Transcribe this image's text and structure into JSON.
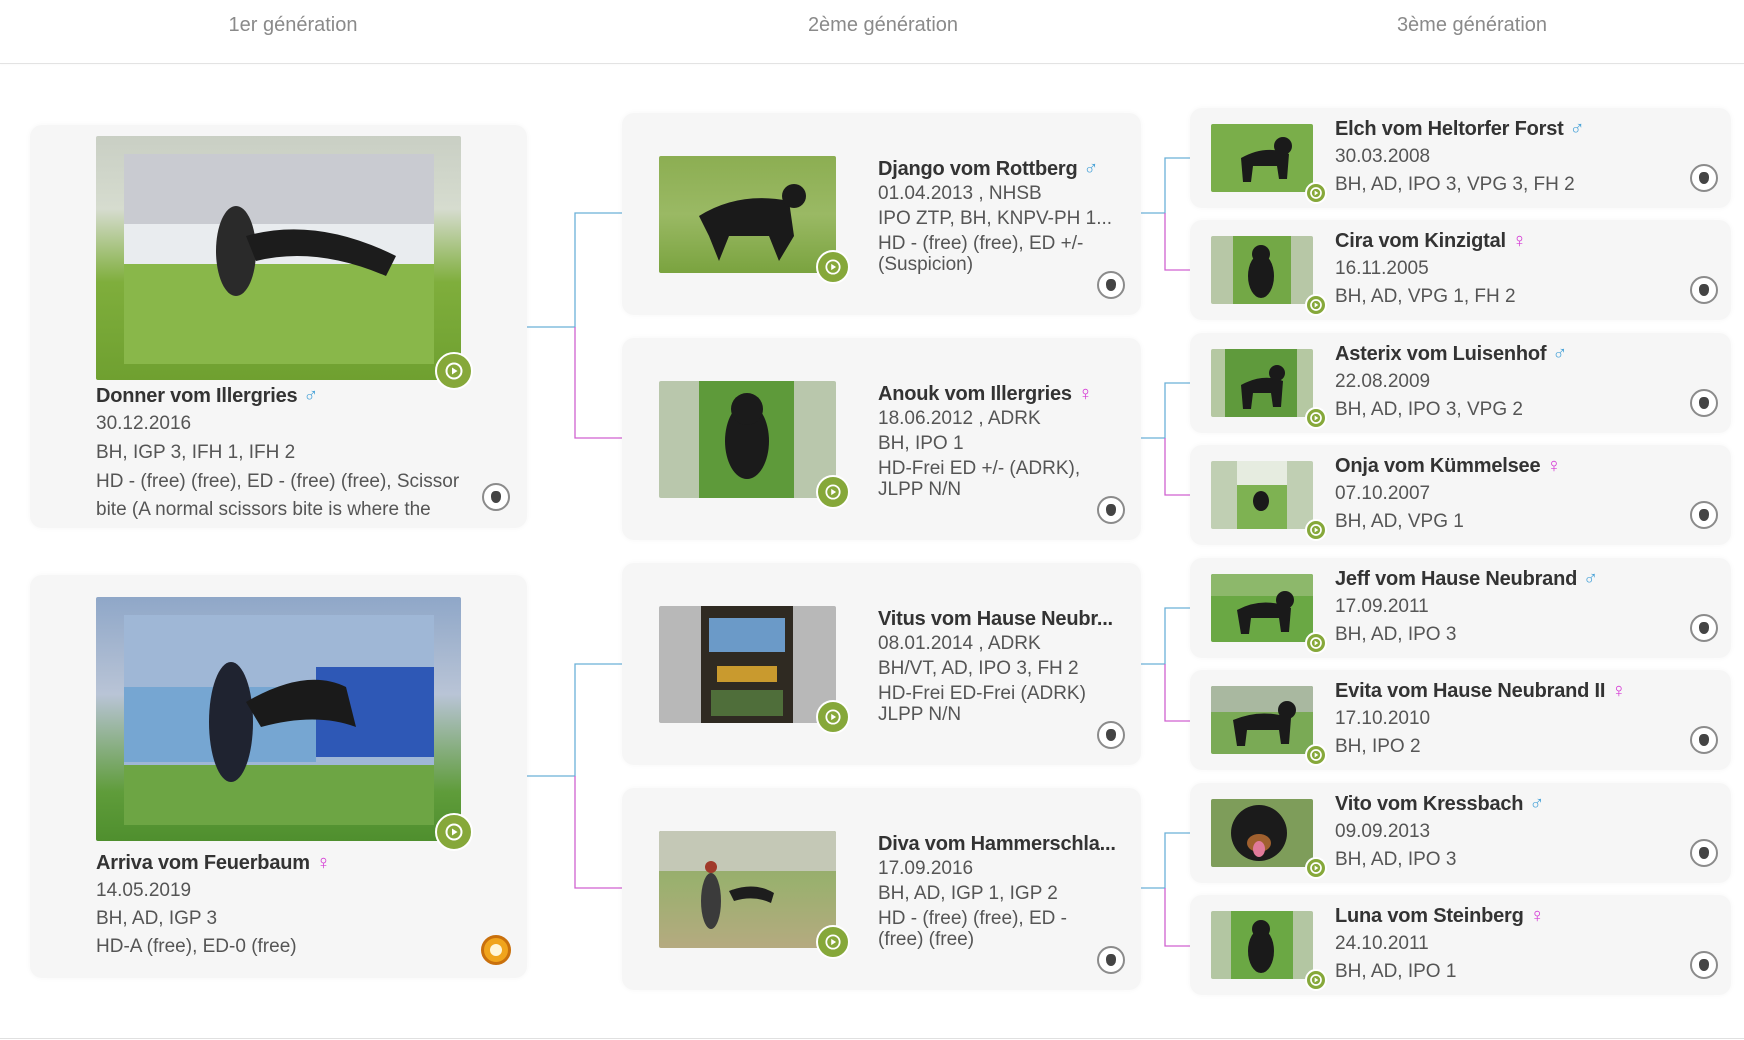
{
  "headers": [
    "1er génération",
    "2ème génération",
    "3ème génération"
  ],
  "gen1": [
    {
      "name": "Donner vom Illergries",
      "sex": "♂",
      "date": "30.12.2016",
      "titles": "BH, IGP 3, IFH 1, IFH 2",
      "health": "HD - (free) (free), ED - (free) (free), Scissor bite (A normal scissors bite is where the"
    },
    {
      "name": "Arriva vom Feuerbaum",
      "sex": "♀",
      "date": "14.05.2019",
      "titles": "BH, AD, IGP 3",
      "health": "HD-A (free), ED-0 (free)"
    }
  ],
  "gen2": [
    {
      "name": "Django vom Rottberg",
      "sex": "♂",
      "date": "01.04.2013 , NHSB",
      "titles": "IPO ZTP, BH, KNPV-PH 1...",
      "health": "HD - (free) (free), ED +/- (Suspicion)"
    },
    {
      "name": "Anouk vom Illergries",
      "sex": "♀",
      "date": "18.06.2012 , ADRK",
      "titles": "BH, IPO 1",
      "health": "HD-Frei ED +/- (ADRK), JLPP N/N"
    },
    {
      "name": "Vitus vom Hause Neubr...",
      "sex": "",
      "date": "08.01.2014 , ADRK",
      "titles": "BH/VT, AD, IPO 3, FH 2",
      "health": "HD-Frei ED-Frei (ADRK) JLPP N/N"
    },
    {
      "name": "Diva vom Hammerschla...",
      "sex": "",
      "date": "17.09.2016",
      "titles": "BH, AD, IGP 1, IGP 2",
      "health": "HD - (free) (free), ED - (free) (free)"
    }
  ],
  "gen3": [
    {
      "name": "Elch vom Heltorfer Forst",
      "sex": "♂",
      "date": "30.03.2008",
      "titles": "BH, AD, IPO 3, VPG 3, FH 2"
    },
    {
      "name": "Cira vom Kinzigtal",
      "sex": "♀",
      "date": "16.11.2005",
      "titles": "BH, AD, VPG 1, FH 2"
    },
    {
      "name": "Asterix vom Luisenhof",
      "sex": "♂",
      "date": "22.08.2009",
      "titles": "BH, AD, IPO 3, VPG 2"
    },
    {
      "name": "Onja vom Kümmelsee",
      "sex": "♀",
      "date": "07.10.2007",
      "titles": "BH, AD, VPG 1"
    },
    {
      "name": "Jeff vom Hause Neubrand",
      "sex": "♂",
      "date": "17.09.2011",
      "titles": "BH, AD, IPO 3"
    },
    {
      "name": "Evita vom Hause Neubrand II",
      "sex": "♀",
      "date": "17.10.2010",
      "titles": "BH, IPO 2"
    },
    {
      "name": "Vito vom Kressbach",
      "sex": "♂",
      "date": "09.09.2013",
      "titles": "BH, AD, IPO 3"
    },
    {
      "name": "Luna vom Steinberg",
      "sex": "♀",
      "date": "24.10.2011",
      "titles": "BH, AD, IPO 1"
    }
  ],
  "colors": {
    "male": "#4aa3d8",
    "female": "#d53ad5",
    "play": "#86a83a",
    "male_line": "#6bb0d8",
    "female_line": "#d062d0"
  }
}
